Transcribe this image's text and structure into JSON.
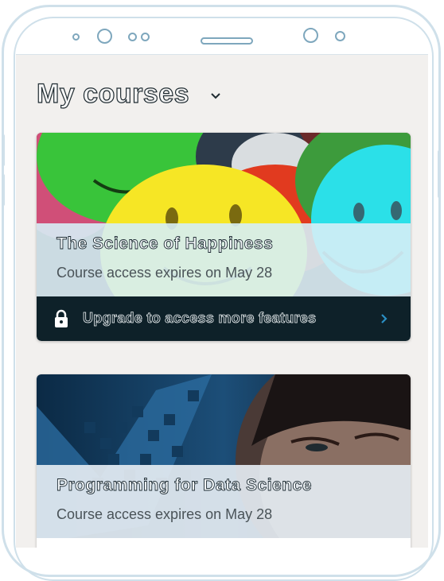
{
  "header": {
    "title": "My courses",
    "dropdown_icon": "chevron-down-icon"
  },
  "courses": [
    {
      "title": "The Science of Happiness",
      "expiry": "Course access expires on May 28",
      "image": "smiley-balls-image",
      "upgrade_label": "Upgrade to access more features",
      "lock_icon": "lock-icon",
      "arrow_icon": "chevron-right-icon"
    },
    {
      "title": "Programming for Data Science",
      "expiry": "Course access expires on May 28",
      "image": "woman-with-data-pixels-image"
    }
  ],
  "colors": {
    "screen_background": "#f2f0ee",
    "upgrade_bar": "#0e2129",
    "arrow": "#2a8fc4",
    "phone_outline": "#cfe0ea"
  }
}
